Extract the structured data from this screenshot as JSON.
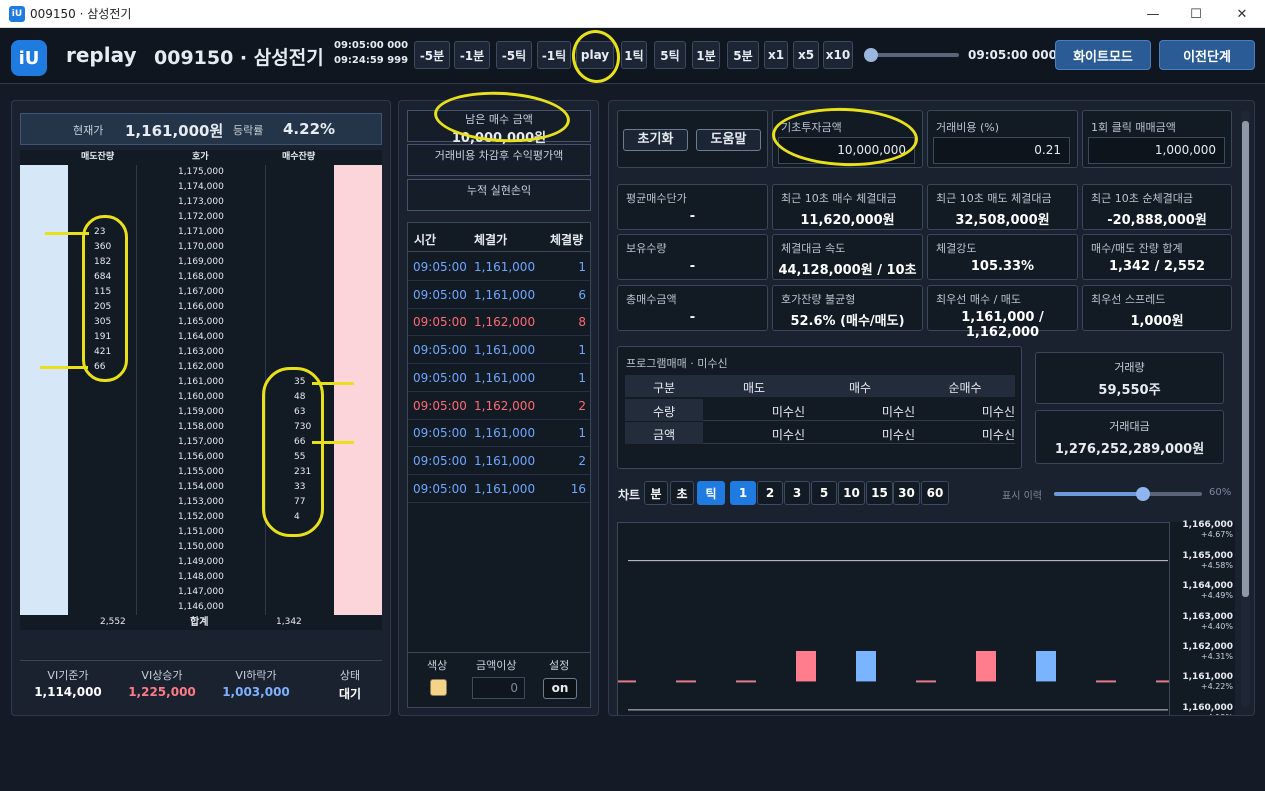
{
  "window": {
    "title": "009150 · 삼성전기",
    "min": "—",
    "max": "☐",
    "close": "✕"
  },
  "header": {
    "logo": "iU",
    "app": "replay",
    "symbol": "009150 · 삼성전기",
    "time1": "09:05:00 000",
    "time2": "09:24:59 999",
    "slider_time": "09:05:00 000",
    "slider_value": 0.05,
    "white_mode": "화이트모드",
    "prev_step": "이전단계"
  },
  "controls": [
    "-5분",
    "-1분",
    "-5틱",
    "-1틱",
    "play",
    "1틱",
    "5틱",
    "1분",
    "5분",
    "x1",
    "x5",
    "x10"
  ],
  "orderbook": {
    "cur_label": "현재가",
    "cur_value": "1,161,000원",
    "rate_label": "등락률",
    "rate_value": "4.22%",
    "headers": [
      "매도잔량",
      "호가",
      "매수잔량"
    ],
    "rows": [
      {
        "p": "1,175,000",
        "s": "",
        "b": ""
      },
      {
        "p": "1,174,000",
        "s": "",
        "b": ""
      },
      {
        "p": "1,173,000",
        "s": "",
        "b": ""
      },
      {
        "p": "1,172,000",
        "s": "",
        "b": ""
      },
      {
        "p": "1,171,000",
        "s": "23",
        "b": ""
      },
      {
        "p": "1,170,000",
        "s": "360",
        "b": ""
      },
      {
        "p": "1,169,000",
        "s": "182",
        "b": ""
      },
      {
        "p": "1,168,000",
        "s": "684",
        "b": ""
      },
      {
        "p": "1,167,000",
        "s": "115",
        "b": ""
      },
      {
        "p": "1,166,000",
        "s": "205",
        "b": ""
      },
      {
        "p": "1,165,000",
        "s": "305",
        "b": ""
      },
      {
        "p": "1,164,000",
        "s": "191",
        "b": ""
      },
      {
        "p": "1,163,000",
        "s": "421",
        "b": ""
      },
      {
        "p": "1,162,000",
        "s": "66",
        "b": ""
      },
      {
        "p": "1,161,000",
        "s": "",
        "b": "35"
      },
      {
        "p": "1,160,000",
        "s": "",
        "b": "48"
      },
      {
        "p": "1,159,000",
        "s": "",
        "b": "63"
      },
      {
        "p": "1,158,000",
        "s": "",
        "b": "730"
      },
      {
        "p": "1,157,000",
        "s": "",
        "b": "66"
      },
      {
        "p": "1,156,000",
        "s": "",
        "b": "55"
      },
      {
        "p": "1,155,000",
        "s": "",
        "b": "231"
      },
      {
        "p": "1,154,000",
        "s": "",
        "b": "33"
      },
      {
        "p": "1,153,000",
        "s": "",
        "b": "77"
      },
      {
        "p": "1,152,000",
        "s": "",
        "b": "4"
      },
      {
        "p": "1,151,000",
        "s": "",
        "b": ""
      },
      {
        "p": "1,150,000",
        "s": "",
        "b": ""
      },
      {
        "p": "1,149,000",
        "s": "",
        "b": ""
      },
      {
        "p": "1,148,000",
        "s": "",
        "b": ""
      },
      {
        "p": "1,147,000",
        "s": "",
        "b": ""
      },
      {
        "p": "1,146,000",
        "s": "",
        "b": ""
      }
    ],
    "total_sell": "2,552",
    "total_label": "합계",
    "total_buy": "1,342",
    "vi": [
      {
        "label": "VI기준가",
        "value": "1,114,000",
        "color": "#ffffff"
      },
      {
        "label": "VI상승가",
        "value": "1,225,000",
        "color": "#ff7b86"
      },
      {
        "label": "VI하락가",
        "value": "1,003,000",
        "color": "#7fb0ff"
      },
      {
        "label": "상태",
        "value": "대기",
        "color": "#ffffff"
      }
    ]
  },
  "mid": {
    "remaining_label": "남은 매수 금액",
    "remaining_value": "10,000,000원",
    "eval_label": "거래비용 차감후 수익평가액",
    "realized_label": "누적 실현손익",
    "trade_headers": [
      "시간",
      "체결가",
      "체결량"
    ],
    "trades": [
      {
        "t": "09:05:00",
        "p": "1,161,000",
        "q": "1",
        "up": false
      },
      {
        "t": "09:05:00",
        "p": "1,161,000",
        "q": "6",
        "up": false
      },
      {
        "t": "09:05:00",
        "p": "1,162,000",
        "q": "8",
        "up": true
      },
      {
        "t": "09:05:00",
        "p": "1,161,000",
        "q": "1",
        "up": false
      },
      {
        "t": "09:05:00",
        "p": "1,161,000",
        "q": "1",
        "up": false
      },
      {
        "t": "09:05:00",
        "p": "1,162,000",
        "q": "2",
        "up": true
      },
      {
        "t": "09:05:00",
        "p": "1,161,000",
        "q": "1",
        "up": false
      },
      {
        "t": "09:05:00",
        "p": "1,161,000",
        "q": "2",
        "up": false
      },
      {
        "t": "09:05:00",
        "p": "1,161,000",
        "q": "16",
        "up": false
      }
    ],
    "settings_headers": [
      "색상",
      "금액이상",
      "설정"
    ],
    "amount": "0",
    "on": "on",
    "swatch": "#f5d48a"
  },
  "right": {
    "reset": "초기화",
    "help": "도움말",
    "base_label": "기초투자금액",
    "base_value": "10,000,000",
    "fee_label": "거래비용 (%)",
    "fee_value": "0.21",
    "click_label": "1회 클릭 매매금액",
    "click_value": "1,000,000",
    "stats": [
      {
        "label": "평균매수단가",
        "value": "-"
      },
      {
        "label": "최근 10초 매수 체결대금",
        "value": "11,620,000원"
      },
      {
        "label": "최근 10초 매도 체결대금",
        "value": "32,508,000원"
      },
      {
        "label": "최근 10초 순체결대금",
        "value": "-20,888,000원"
      },
      {
        "label": "보유수량",
        "value": "-"
      },
      {
        "label": "체결대금 속도",
        "value": "44,128,000원 / 10초"
      },
      {
        "label": "체결강도",
        "value": "105.33%"
      },
      {
        "label": "매수/매도 잔량 합계",
        "value": "1,342 / 2,552"
      },
      {
        "label": "총매수금액",
        "value": "-"
      },
      {
        "label": "호가잔량 불균형",
        "value": "52.6% (매수/매도)"
      },
      {
        "label": "최우선 매수 / 매도",
        "value": "1,161,000 / 1,162,000"
      },
      {
        "label": "최우선 스프레드",
        "value": "1,000원"
      }
    ],
    "program": {
      "title": "프로그램매매 · 미수신",
      "headers": [
        "구분",
        "매도",
        "매수",
        "순매수"
      ],
      "rows": [
        [
          "수량",
          "미수신",
          "미수신",
          "미수신"
        ],
        [
          "금액",
          "미수신",
          "미수신",
          "미수신"
        ]
      ]
    },
    "volume_label": "거래량",
    "volume_value": "59,550주",
    "amount_label": "거래대금",
    "amount_value": "1,276,252,289,000원",
    "chart_label": "차트",
    "chart_units": [
      "분",
      "초",
      "틱"
    ],
    "chart_periods": [
      "1",
      "2",
      "3",
      "5",
      "10",
      "15",
      "30",
      "60"
    ],
    "history_label": "표시 이력",
    "history_value": "60%",
    "history_fraction": 0.6
  },
  "chart_data": {
    "type": "bar",
    "y_ticks": [
      {
        "price": "1,165,000",
        "pct": "+4.58%"
      },
      {
        "price": "1,164,000",
        "pct": "+4.49%"
      },
      {
        "price": "1,163,000",
        "pct": "+4.40%"
      },
      {
        "price": "1,162,000",
        "pct": "+4.31%"
      },
      {
        "price": "1,161,000",
        "pct": "+4.22%"
      },
      {
        "price": "1,160,000",
        "pct": "+4.13%"
      }
    ],
    "top_tick": {
      "price": "1,166,000",
      "pct": "+4.67%"
    },
    "bars": [
      {
        "dir": "flat",
        "o": 1161000,
        "c": 1161000
      },
      {
        "dir": "flat",
        "o": 1161000,
        "c": 1161000
      },
      {
        "dir": "flat",
        "o": 1161000,
        "c": 1161000
      },
      {
        "dir": "up",
        "o": 1161000,
        "c": 1162000
      },
      {
        "dir": "down",
        "o": 1162000,
        "c": 1161000
      },
      {
        "dir": "flat",
        "o": 1161000,
        "c": 1161000
      },
      {
        "dir": "up",
        "o": 1161000,
        "c": 1162000
      },
      {
        "dir": "down",
        "o": 1162000,
        "c": 1161000
      },
      {
        "dir": "flat",
        "o": 1161000,
        "c": 1161000
      },
      {
        "dir": "flat",
        "o": 1161000,
        "c": 1161000
      }
    ],
    "ylim": [
      1159800,
      1166200
    ]
  }
}
